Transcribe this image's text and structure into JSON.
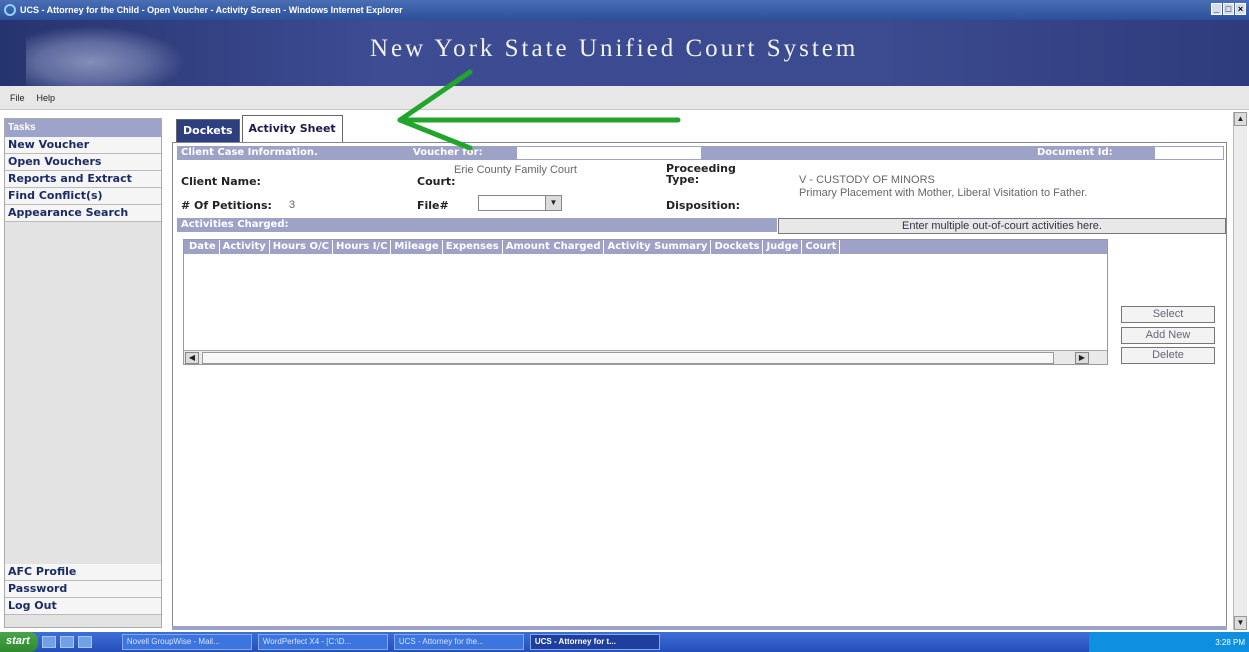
{
  "window": {
    "title": "UCS - Attorney for the Child - Open Voucher - Activity Screen - Windows Internet Explorer",
    "controls": [
      "_",
      "□",
      "×"
    ]
  },
  "banner": {
    "title": "New York State Unified Court System"
  },
  "menu": {
    "items": [
      "File",
      "Help"
    ]
  },
  "sidebar": {
    "header": "Tasks",
    "items": [
      {
        "label": "New Voucher"
      },
      {
        "label": "Open Vouchers"
      },
      {
        "label": "Reports and Extract"
      },
      {
        "label": "Find Conflict(s)"
      },
      {
        "label": "Appearance Search"
      }
    ],
    "bottom_items": [
      {
        "label": "AFC Profile"
      },
      {
        "label": "Password"
      },
      {
        "label": "Log Out"
      }
    ]
  },
  "tabs": [
    {
      "label": "Dockets",
      "active": false
    },
    {
      "label": "Activity Sheet",
      "active": true
    }
  ],
  "case_info": {
    "section_title": "Client Case Information.",
    "voucher_for_label": "Voucher for:",
    "document_id_label": "Document Id:",
    "client_name_label": "Client Name:",
    "court_label": "Court:",
    "court_value": "Erie County Family Court",
    "proceeding_type_label": "Proceeding Type:",
    "proceeding_type_value": "V - CUSTODY OF MINORS",
    "petitions_label": "# Of Petitions:",
    "petitions_value": "3",
    "file_label": "File#",
    "disposition_label": "Disposition:",
    "disposition_value": "Primary Placement with Mother, Liberal Visitation to Father."
  },
  "activities": {
    "section_title": "Activities Charged:",
    "multi_button": "Enter multiple out-of-court activities here.",
    "columns": [
      "Date",
      "Activity",
      "Hours O/C",
      "Hours I/C",
      "Mileage",
      "Expenses",
      "Amount Charged",
      "Activity Summary",
      "Dockets",
      "Judge",
      "Court"
    ],
    "rows": []
  },
  "buttons": {
    "select": "Select",
    "add_new": "Add New",
    "delete": "Delete"
  },
  "taskbar": {
    "start": "start",
    "tasks": [
      {
        "label": "Novell GroupWise - Mail...",
        "active": false
      },
      {
        "label": "WordPerfect X4 - [C:\\D...",
        "active": false
      },
      {
        "label": "UCS - Attorney for the...",
        "active": false
      },
      {
        "label": "UCS - Attorney for t...",
        "active": true
      }
    ],
    "clock": "3:28 PM"
  },
  "colors": {
    "annotation_arrow": "#22a52c",
    "banner": "#3c4a8f",
    "section_bar": "#9da2c6"
  }
}
